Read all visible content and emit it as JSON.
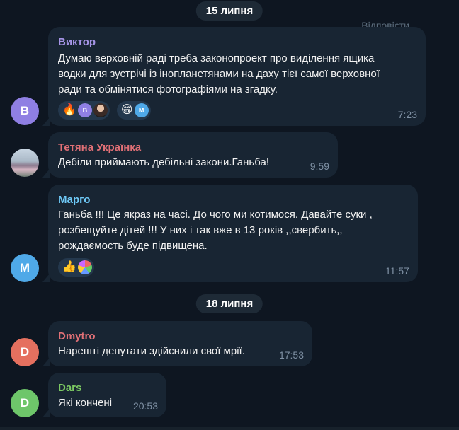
{
  "dates": [
    "15 липня",
    "18 липня"
  ],
  "reply_hint": "Відповісти",
  "messages": [
    {
      "sender": "Виктор",
      "sender_color": "#a695e7",
      "avatar_letter": "В",
      "avatar_color": "#8f7fe3",
      "lines": [
        "Думаю верховній раді треба законопроект про виділення ящика",
        "водки для зустрічі із інопланетянами на даху тієї самої верховної",
        "ради та обмінятися фотографіями на згадку."
      ],
      "time": "7:23",
      "reactions": [
        {
          "emoji": "🔥",
          "icon": "fire-icon",
          "users": [
            "В",
            "photo"
          ]
        },
        {
          "emoji": "😁",
          "icon": "grin-icon",
          "users": [
            "М"
          ]
        }
      ]
    },
    {
      "sender": "Тетяна Українка",
      "sender_color": "#e17076",
      "avatar_letter": "",
      "avatar_color": "#6b7b8c",
      "lines": [
        "Дебіли приймають дебільні закони.Ганьба!"
      ],
      "time": "9:59",
      "reactions": []
    },
    {
      "sender": "Марго",
      "sender_color": "#6ec9f7",
      "avatar_letter": "М",
      "avatar_color": "#4fa9e8",
      "lines": [
        "Ганьба !!! Це якраз на часі. До чого ми котимося. Давайте суки ,",
        "розбещуйте дітей !!!  У них і так вже в 13 років ,,свербить,,",
        "рождаємость буде підвищена."
      ],
      "time": "11:57",
      "reactions": [
        {
          "emoji": "👍",
          "icon": "thumbs-up-icon",
          "users": [
            "photo2"
          ]
        }
      ]
    },
    {
      "sender": "Dmytro",
      "sender_color": "#e17076",
      "avatar_letter": "D",
      "avatar_color": "#e5705f",
      "lines": [
        "Нарешті депутати здійснили свої мрії."
      ],
      "time": "17:53",
      "reactions": []
    },
    {
      "sender": "Dars",
      "sender_color": "#7bc862",
      "avatar_letter": "D",
      "avatar_color": "#6ec66a",
      "lines": [
        "Які кончені"
      ],
      "time": "20:53",
      "reactions": []
    }
  ],
  "colors": {
    "background": "#0e1621",
    "bubble": "#182533",
    "time": "#7f91a4",
    "pill": "#1e2a36",
    "reaction_bg": "#24384d"
  }
}
